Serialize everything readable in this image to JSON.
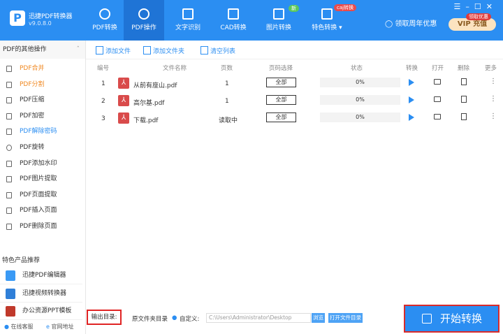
{
  "app": {
    "name": "迅捷PDF转换器",
    "version": "v9.0.8.0"
  },
  "nav": [
    {
      "label": "PDF转换"
    },
    {
      "label": "PDF操作"
    },
    {
      "label": "文字识别"
    },
    {
      "label": "CAD转换"
    },
    {
      "label": "图片转换",
      "badge": "新"
    },
    {
      "label": "特色转换",
      "badge": "caj转换"
    }
  ],
  "header": {
    "promo": "领取周年优惠",
    "vip": "VIP 充值",
    "vip_badge": "领取优惠"
  },
  "sidebar": {
    "title": "PDF的其他操作",
    "items": [
      {
        "label": "PDF合并"
      },
      {
        "label": "PDF分割"
      },
      {
        "label": "PDF压缩"
      },
      {
        "label": "PDF加密"
      },
      {
        "label": "PDF解除密码"
      },
      {
        "label": "PDF旋转"
      },
      {
        "label": "PDF添加水印"
      },
      {
        "label": "PDF图片提取"
      },
      {
        "label": "PDF页面提取"
      },
      {
        "label": "PDF插入页面"
      },
      {
        "label": "PDF删除页面"
      }
    ],
    "section": "特色产品推荐",
    "products": [
      "迅捷PDF编辑器",
      "迅捷视频转换器",
      "办公资源PPT模板"
    ],
    "footer": [
      "在线客服",
      "官网地址"
    ]
  },
  "toolbar": {
    "add_file": "添加文件",
    "add_folder": "添加文件夹",
    "clear": "清空列表"
  },
  "table": {
    "headers": [
      "编号",
      "文件名称",
      "页数",
      "页码选择",
      "状态",
      "转换",
      "打开",
      "删除",
      "更多"
    ],
    "rows": [
      {
        "num": "1",
        "name": "从前有座山.pdf",
        "pages": "1",
        "range": "全部",
        "status": "0%"
      },
      {
        "num": "2",
        "name": "高尔基.pdf",
        "pages": "1",
        "range": "全部",
        "status": "0%"
      },
      {
        "num": "3",
        "name": "下载.pdf",
        "pages": "读取中",
        "range": "全部",
        "status": "0%"
      }
    ]
  },
  "output": {
    "label": "输出目录:",
    "original": "原文件夹目录",
    "custom": "自定义:",
    "path": "C:\\Users\\Administrator\\Desktop",
    "browse": "浏览",
    "open": "打开文件目录"
  },
  "start": "开始转换"
}
